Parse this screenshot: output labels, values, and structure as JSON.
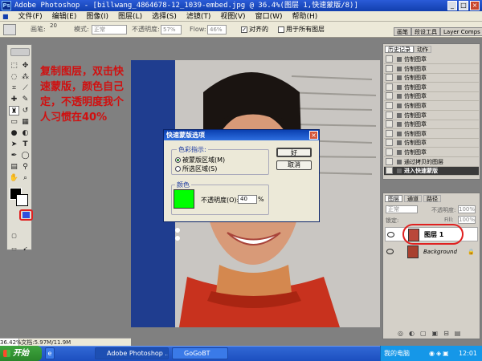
{
  "window": {
    "title": "Adobe Photoshop - [billwang_4864678-12_1039-embed.jpg @ 36.4%(图层 1,快速蒙版/8)]",
    "app_icon_text": "Ps",
    "minimize": "_",
    "maximize": "□",
    "close": "×"
  },
  "menu": [
    "文件(F)",
    "编辑(E)",
    "图像(I)",
    "图层(L)",
    "选择(S)",
    "滤镜(T)",
    "视图(V)",
    "窗口(W)",
    "帮助(H)"
  ],
  "options": {
    "brush_label": "画笔:",
    "brush_size": "20",
    "mode_label": "模式:",
    "mode_value": "正常",
    "opacity_label": "不透明度:",
    "opacity_value": "57%",
    "flow_label": "Flow:",
    "flow_value": "46%",
    "aligned_label": "对齐的",
    "all_layers_label": "用于所有图层"
  },
  "panel_tabs": [
    "画笔",
    "段设工具",
    "Layer Comps"
  ],
  "callout_text": "复制图层，双击快速蒙版，颜色自己定，不透明度我个人习惯在40%",
  "dialog": {
    "title": "快速蒙版选项",
    "color_indicates_label": "色彩指示:",
    "option_masked": "被蒙版区域(M)",
    "option_selected": "所选区域(S)",
    "color_group_label": "颜色",
    "opacity_label": "不透明度(O):",
    "opacity_value": "40",
    "percent": "%",
    "ok_label": "好",
    "cancel_label": "取消",
    "close_label": "×",
    "swatch_color": "#00ff00"
  },
  "history": {
    "tabs": [
      "历史记录",
      "动作"
    ],
    "items": [
      {
        "label": "仿制图章",
        "active": false
      },
      {
        "label": "仿制图章",
        "active": false
      },
      {
        "label": "仿制图章",
        "active": false
      },
      {
        "label": "仿制图章",
        "active": false
      },
      {
        "label": "仿制图章",
        "active": false
      },
      {
        "label": "仿制图章",
        "active": false
      },
      {
        "label": "仿制图章",
        "active": false
      },
      {
        "label": "仿制图章",
        "active": false
      },
      {
        "label": "仿制图章",
        "active": false
      },
      {
        "label": "仿制图章",
        "active": false
      },
      {
        "label": "仿制图章",
        "active": false
      },
      {
        "label": "通过拷贝的图层",
        "active": false
      },
      {
        "label": "进入快速蒙版",
        "active": true
      }
    ]
  },
  "layers": {
    "tabs": [
      "图层",
      "通道",
      "路径"
    ],
    "blend_mode": "正常",
    "opacity_label": "不透明度:",
    "opacity_value": "100%",
    "lock_label": "锁定:",
    "fill_label": "Fill:",
    "fill_value": "100%",
    "items": [
      {
        "name": "图层 1",
        "highlighted": true
      },
      {
        "name": "Background",
        "highlighted": false
      }
    ]
  },
  "status": {
    "zoom": "36.42%",
    "doc": "文档:5.97M/11.9M"
  },
  "taskbar": {
    "start": "开始",
    "tasks": [
      "Adobe Photoshop ...",
      "GoGoBT"
    ],
    "tray_label": "我的电脑",
    "clock": "12:01"
  },
  "colors": {
    "accent_red": "#d01010",
    "title_blue": "#1b4ec2",
    "mask_swatch": "#00ff00"
  }
}
